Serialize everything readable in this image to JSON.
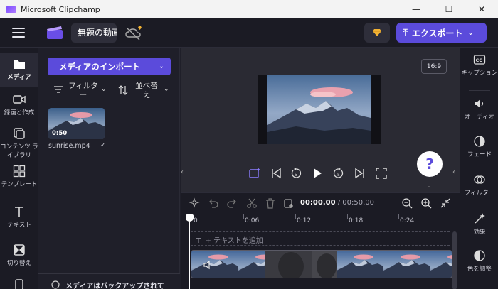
{
  "window": {
    "title": "Microsoft Clipchamp",
    "minimize": "—",
    "maximize": "☐",
    "close": "✕"
  },
  "header": {
    "project_name": "無題の動画",
    "export_label": "エクスポート",
    "export_icon": "⤒",
    "export_chevron": "⌄"
  },
  "left_rail": {
    "items": [
      {
        "label": "メディア",
        "icon": "folder-icon",
        "active": true
      },
      {
        "label": "録画と作成",
        "icon": "camera-icon"
      },
      {
        "label": "コンテンツ ライブラリ",
        "icon": "library-icon"
      },
      {
        "label": "テンプレート",
        "icon": "template-icon"
      },
      {
        "label": "テキスト",
        "icon": "text-icon"
      },
      {
        "label": "切り替え",
        "icon": "transition-icon"
      }
    ]
  },
  "media_panel": {
    "import_label": "メディアのインポート",
    "import_chevron": "⌄",
    "filter_label": "フィルター",
    "sort_label": "並べ替え",
    "files": [
      {
        "name": "sunrise.mp4",
        "duration": "0:50",
        "check": "✓"
      }
    ],
    "backup_text": "メディアはバックアップされて"
  },
  "preview": {
    "aspect_ratio": "16:9",
    "help": "?"
  },
  "timeline": {
    "current_time": "00:00.00",
    "total_time": " / 00:50.00",
    "ticks": [
      "0",
      "0:06",
      "0:12",
      "0:18",
      "0:24"
    ],
    "add_text": "+ テキストを追加",
    "text_icon": "T"
  },
  "right_rail": {
    "items": [
      {
        "label": "キャプション",
        "icon": "captions-icon"
      },
      {
        "label": "オーディオ",
        "icon": "speaker-icon"
      },
      {
        "label": "フェード",
        "icon": "fade-icon"
      },
      {
        "label": "フィルター",
        "icon": "filter-icon"
      },
      {
        "label": "効果",
        "icon": "effects-icon"
      },
      {
        "label": "色を調整",
        "icon": "color-adjust-icon"
      }
    ]
  }
}
